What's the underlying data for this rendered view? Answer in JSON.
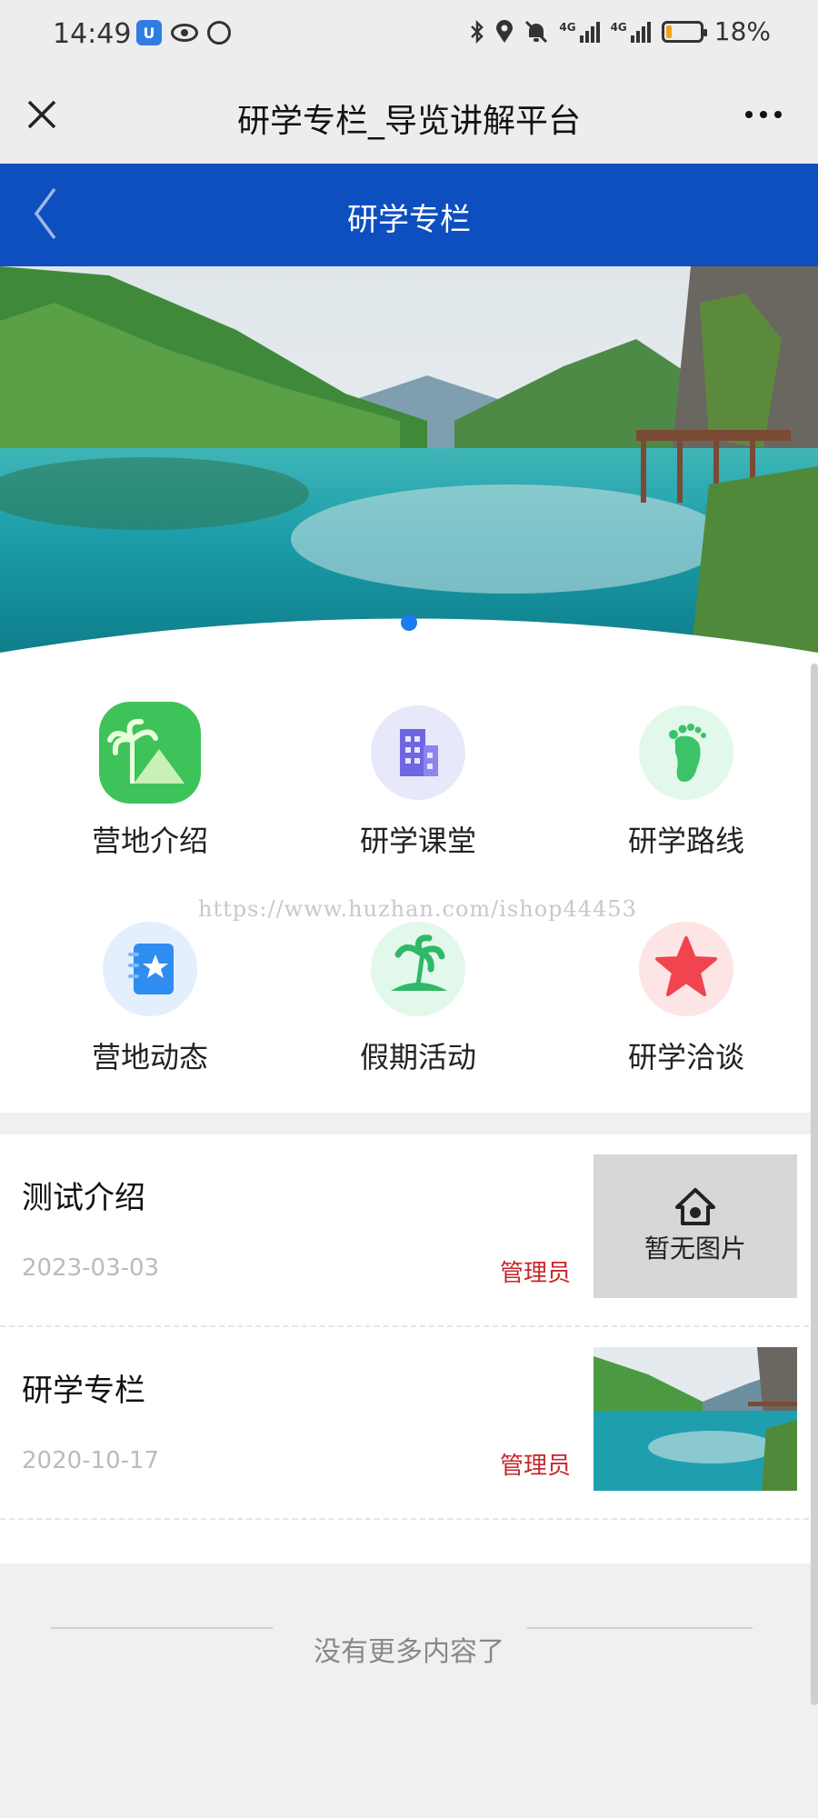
{
  "status_bar": {
    "time": "14:49",
    "battery": "18%",
    "battery_level": 0.18,
    "signal_labels": [
      "4G",
      "4G"
    ],
    "icons": [
      "shield-badge-icon",
      "eye-icon",
      "alarm-icon",
      "bluetooth-icon",
      "location-icon",
      "mute-icon",
      "signal-icon",
      "battery-icon"
    ]
  },
  "title_bar": {
    "title": "研学专栏_导览讲解平台",
    "close_icon": "close-icon",
    "more_icon": "more-icon"
  },
  "header": {
    "title": "研学专栏",
    "back_icon": "chevron-left-icon",
    "color": "#0d4fbf"
  },
  "banner": {
    "slide_count": 1,
    "active_dot_color": "#1a7cf0"
  },
  "menu": {
    "items": [
      {
        "label": "营地介绍",
        "icon": "palm-mountain-icon"
      },
      {
        "label": "研学课堂",
        "icon": "building-icon"
      },
      {
        "label": "研学路线",
        "icon": "footprint-icon"
      },
      {
        "label": "营地动态",
        "icon": "star-notebook-icon"
      },
      {
        "label": "假期活动",
        "icon": "island-icon"
      },
      {
        "label": "研学洽谈",
        "icon": "star-icon"
      }
    ],
    "watermark": "https://www.huzhan.com/ishop44453"
  },
  "list": {
    "items": [
      {
        "title": "测试介绍",
        "date": "2023-03-03",
        "author": "管理员",
        "thumb_text": "暂无图片"
      },
      {
        "title": "研学专栏",
        "date": "2020-10-17",
        "author": "管理员",
        "thumb_text": ""
      }
    ],
    "author_color": "#c8262b"
  },
  "footer": {
    "end_text": "没有更多内容了"
  }
}
